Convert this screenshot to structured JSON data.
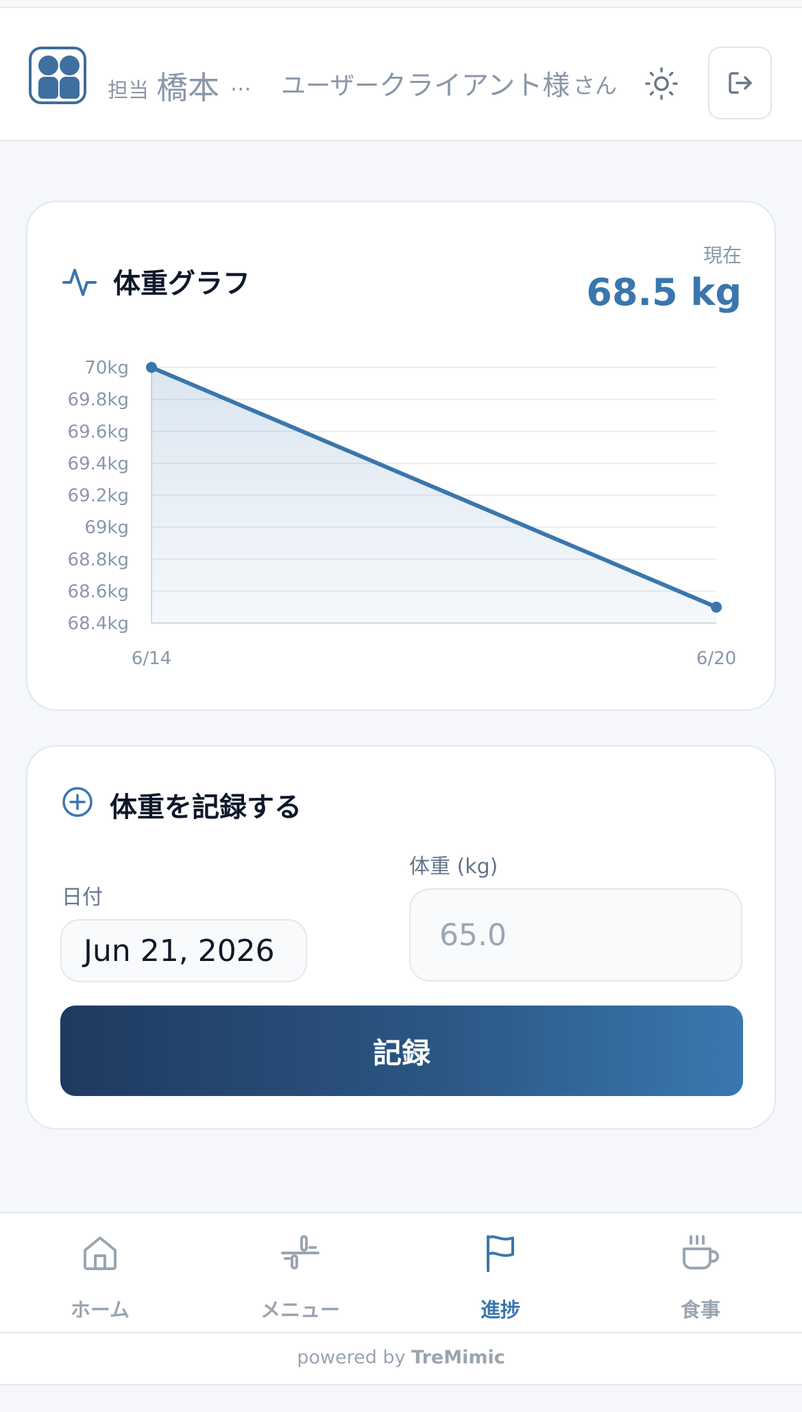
{
  "header": {
    "staff_label": "担当",
    "staff_name": "橋本",
    "staff_ellipsis": "...",
    "user_label": "ユーザー",
    "user_name": "クライアント様",
    "user_suffix": "さん",
    "logo_icon": "app-logo-icon",
    "theme_icon": "sun-icon",
    "logout_icon": "logout-icon"
  },
  "weight_chart": {
    "title": "体重グラフ",
    "icon": "activity-pulse-icon",
    "current_label": "現在",
    "current_value": "68.5 kg"
  },
  "chart_data": {
    "type": "area",
    "x": [
      "6/14",
      "6/20"
    ],
    "y": [
      70.0,
      68.5
    ],
    "yticks": [
      "70kg",
      "69.8kg",
      "69.6kg",
      "69.4kg",
      "69.2kg",
      "69kg",
      "68.8kg",
      "68.6kg",
      "68.4kg"
    ],
    "ytick_values": [
      70.0,
      69.8,
      69.6,
      69.4,
      69.2,
      69.0,
      68.8,
      68.6,
      68.4
    ],
    "ylim": [
      68.4,
      70.0
    ],
    "xlabel": "",
    "ylabel": "",
    "grid": true,
    "color": "#3a76ad"
  },
  "record_form": {
    "title": "体重を記録する",
    "icon": "plus-circle-icon",
    "date_label": "日付",
    "date_value": "Jun 21, 2026",
    "weight_label": "体重 (kg)",
    "weight_placeholder": "65.0",
    "submit_label": "記録"
  },
  "bottom_nav": {
    "items": [
      {
        "label": "ホーム",
        "icon": "home-icon",
        "active": false
      },
      {
        "label": "メニュー",
        "icon": "dumbbell-menu-icon",
        "active": false
      },
      {
        "label": "進捗",
        "icon": "flag-icon",
        "active": true
      },
      {
        "label": "食事",
        "icon": "coffee-cup-icon",
        "active": false
      }
    ]
  },
  "footer": {
    "prefix": "powered by",
    "brand": "TreMimic"
  },
  "colors": {
    "accent": "#3a76ad",
    "button_gradient_start": "#1f3a5f",
    "button_gradient_end": "#3a78b0",
    "muted_text": "#8a97a8"
  }
}
